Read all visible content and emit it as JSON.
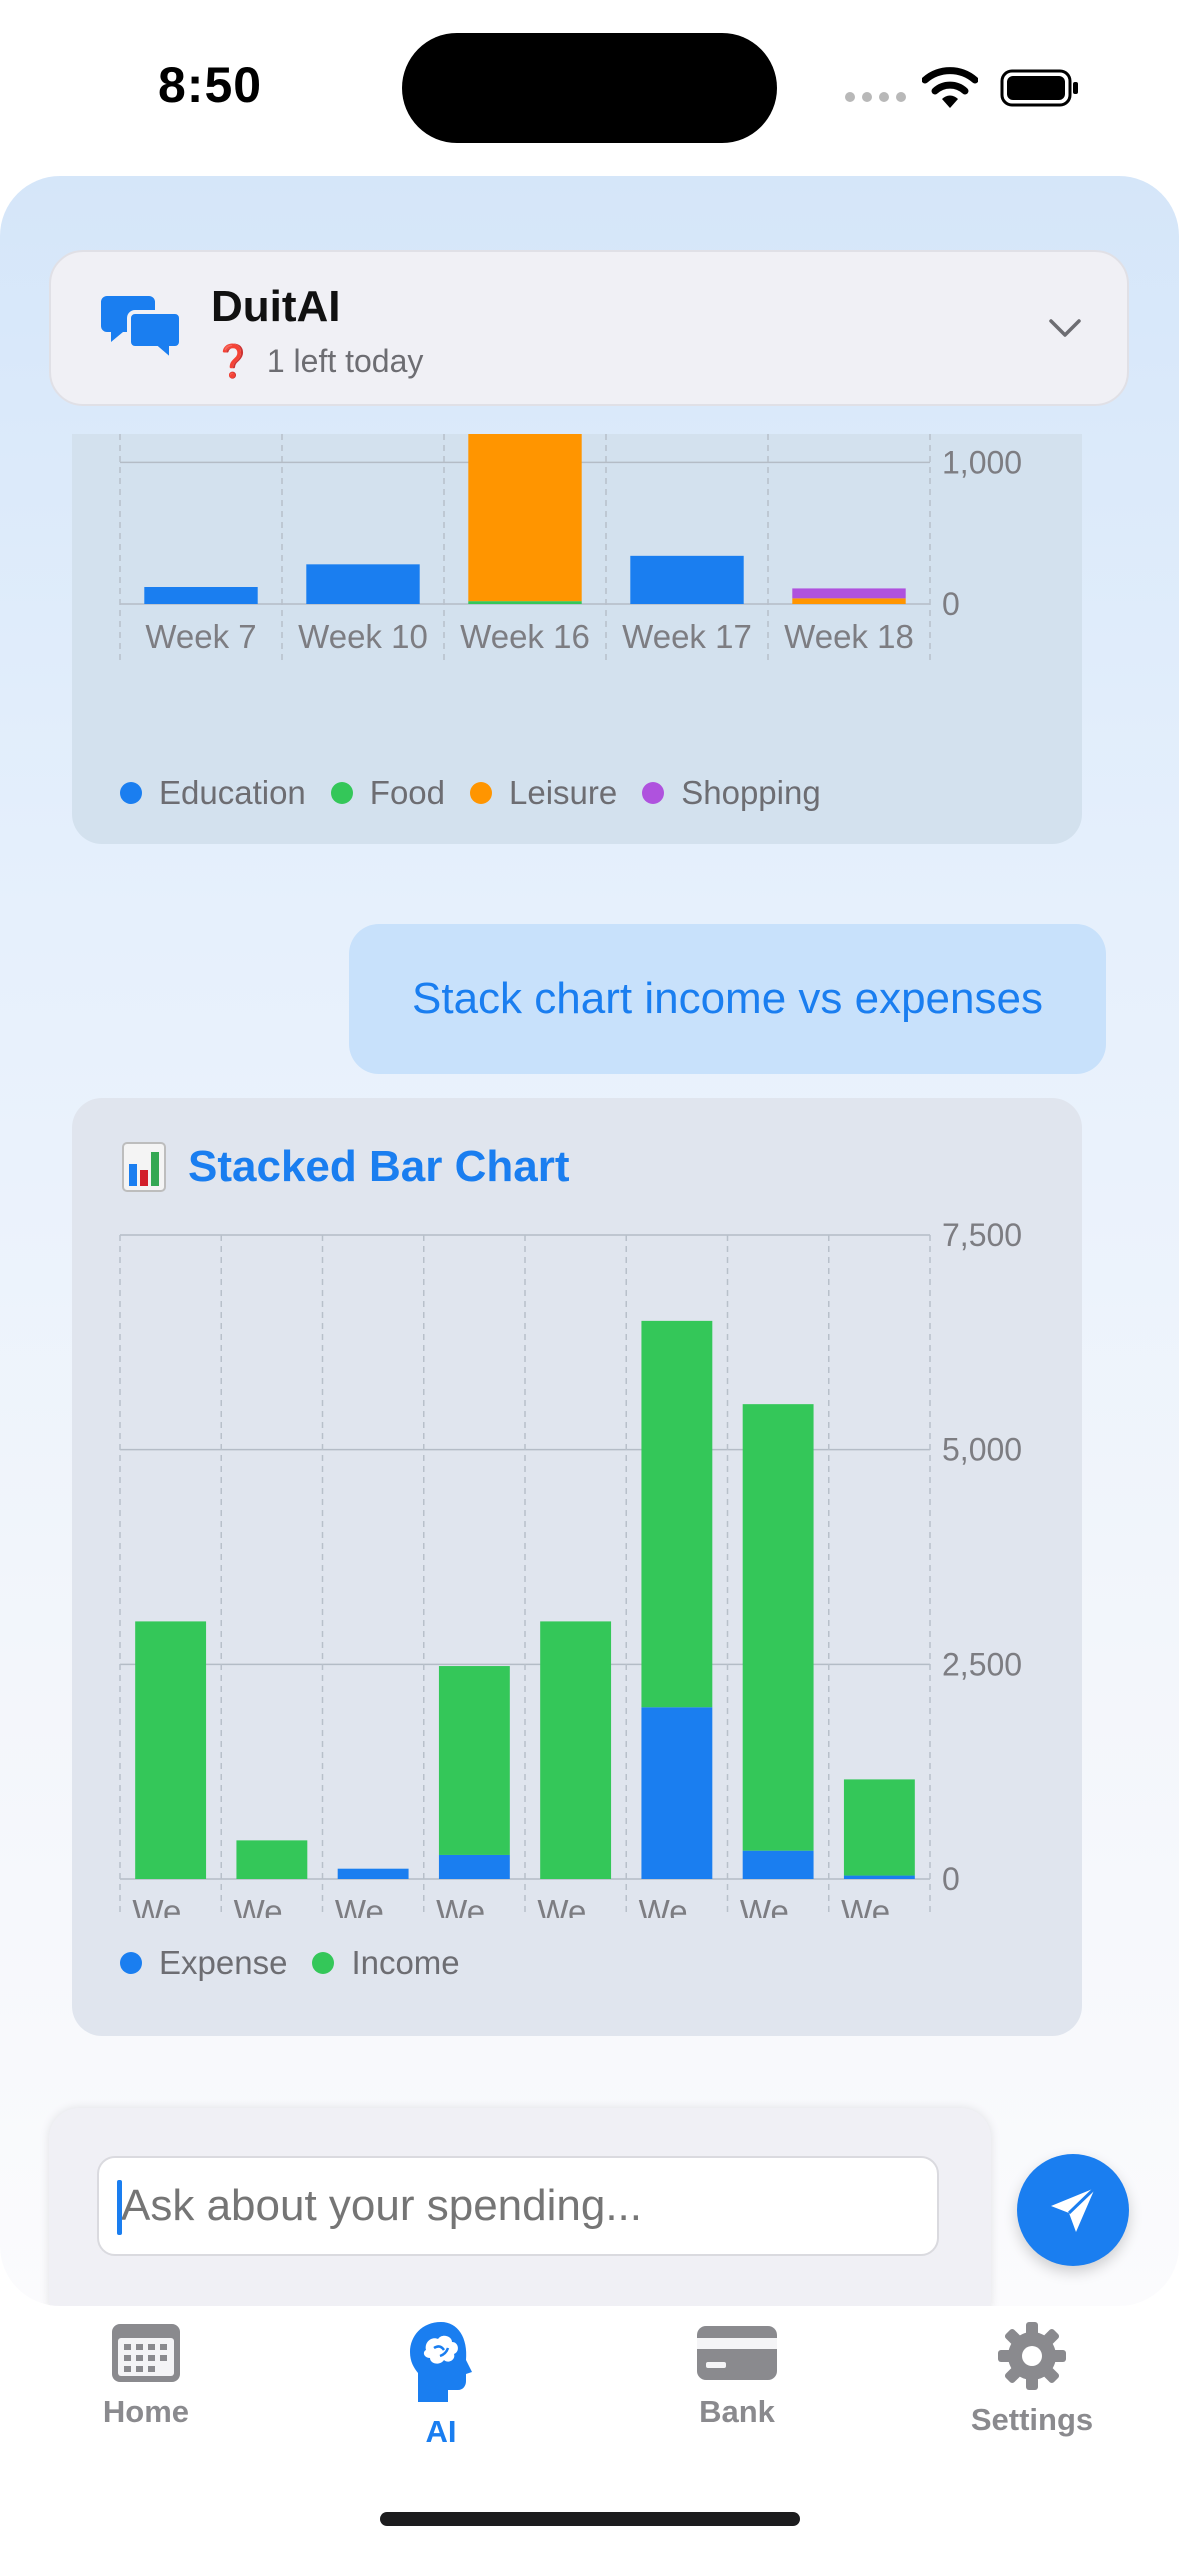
{
  "status_bar": {
    "time": "8:50"
  },
  "header": {
    "title": "DuitAI",
    "status_emoji": "❓",
    "status_text": "1 left today",
    "icon": "chat-bubbles-icon",
    "expand_icon": "chevron-down-icon"
  },
  "colors": {
    "accent": "#1a7ef0",
    "education": "#1a7ef0",
    "food": "#34c759",
    "leisure": "#ff9500",
    "shopping": "#af52de",
    "expense": "#1a7ef0",
    "income": "#34c759"
  },
  "chat": {
    "user_message": "Stack chart income vs expenses",
    "input_placeholder": "Ask about your spending..."
  },
  "chart_data": [
    {
      "type": "bar",
      "stacked": true,
      "categories": [
        "Week 7",
        "Week 10",
        "Week 16",
        "Week 17",
        "Week 18"
      ],
      "series": [
        {
          "name": "Education",
          "color": "#1a7ef0",
          "values": [
            120,
            280,
            0,
            340,
            0
          ]
        },
        {
          "name": "Food",
          "color": "#34c759",
          "values": [
            0,
            0,
            20,
            0,
            0
          ]
        },
        {
          "name": "Leisure",
          "color": "#ff9500",
          "values": [
            0,
            0,
            1200,
            0,
            40
          ]
        },
        {
          "name": "Shopping",
          "color": "#af52de",
          "values": [
            0,
            0,
            0,
            0,
            70
          ]
        }
      ],
      "y_ticks": [
        "1,000",
        "0"
      ],
      "ylim": [
        0,
        1200
      ],
      "legend": "bottom"
    },
    {
      "type": "bar",
      "stacked": true,
      "title": "Stacked Bar Chart",
      "categories": [
        "We...",
        "We...",
        "We...",
        "We...",
        "We...",
        "We...",
        "We...",
        "We..."
      ],
      "series": [
        {
          "name": "Expense",
          "color": "#1a7ef0",
          "values": [
            0,
            0,
            120,
            280,
            0,
            2000,
            330,
            40
          ]
        },
        {
          "name": "Income",
          "color": "#34c759",
          "values": [
            3000,
            450,
            0,
            2200,
            3000,
            4500,
            5200,
            1120
          ]
        }
      ],
      "y_ticks": [
        "7,500",
        "5,000",
        "2,500",
        "0"
      ],
      "ylim": [
        0,
        7500
      ],
      "legend": "bottom"
    }
  ],
  "tab_bar": {
    "items": [
      {
        "label": "Home",
        "icon": "calendar-icon",
        "active": false
      },
      {
        "label": "AI",
        "icon": "brain-head-icon",
        "active": true
      },
      {
        "label": "Bank",
        "icon": "credit-card-icon",
        "active": false
      },
      {
        "label": "Settings",
        "icon": "gear-icon",
        "active": false
      }
    ]
  }
}
